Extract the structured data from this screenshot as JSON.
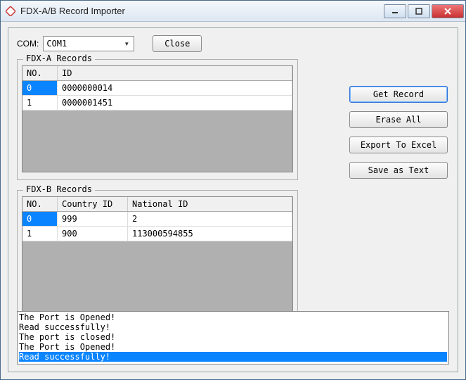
{
  "window": {
    "title": "FDX-A/B Record Importer"
  },
  "top": {
    "com_label": "COM: ",
    "com_value": "COM1",
    "close_label": "Close"
  },
  "side": {
    "get_record": "Get Record",
    "erase_all": "Erase All",
    "export_excel": "Export To Excel",
    "save_text": "Save as Text"
  },
  "fdx_a": {
    "legend": "FDX-A Records",
    "headers": {
      "no": "NO.",
      "id": "ID"
    },
    "rows": [
      {
        "no": "0",
        "id": "0000000014"
      },
      {
        "no": "1",
        "id": "0000001451"
      }
    ]
  },
  "fdx_b": {
    "legend": "FDX-B Records",
    "headers": {
      "no": "NO.",
      "country": "Country ID",
      "national": "National ID"
    },
    "rows": [
      {
        "no": "0",
        "country": "999",
        "national": "2"
      },
      {
        "no": "1",
        "country": "900",
        "national": "113000594855"
      }
    ]
  },
  "log": {
    "lines": [
      "The Port is Opened!",
      "Read successfully!",
      "The port is closed!",
      "The Port is Opened!",
      "Read successfully!"
    ],
    "selected_index": 4
  }
}
